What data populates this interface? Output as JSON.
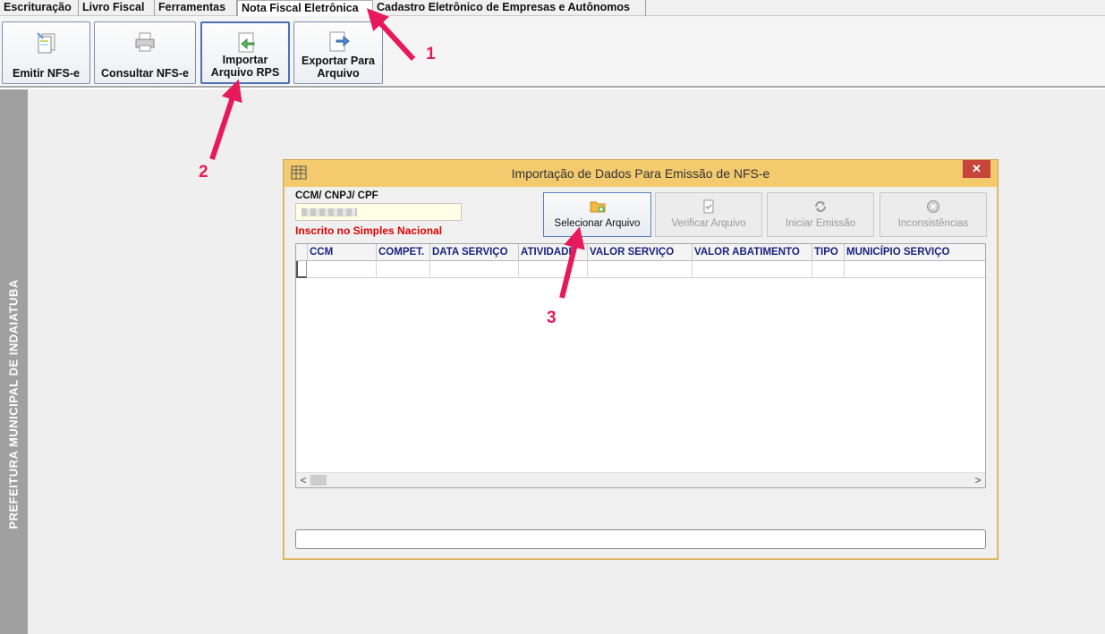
{
  "menu": {
    "tabs": [
      {
        "label": "Escrituração"
      },
      {
        "label": "Livro Fiscal"
      },
      {
        "label": "Ferramentas"
      },
      {
        "label": "Nota Fiscal Eletrônica"
      },
      {
        "label": "Cadastro Eletrônico de Empresas e Autônomos"
      }
    ],
    "active_tab": "Nota Fiscal Eletrônica"
  },
  "toolbar": {
    "buttons": [
      {
        "label": "Emitir NFS-e",
        "icon": "emit-document-icon"
      },
      {
        "label": "Consultar NFS-e",
        "icon": "printer-icon"
      },
      {
        "label": "Importar Arquivo RPS",
        "icon": "import-arrow-icon"
      },
      {
        "label": "Exportar Para Arquivo",
        "icon": "export-arrow-icon"
      }
    ]
  },
  "sidebar": {
    "text": "PREFEITURA MUNICIPAL DE INDAIATUBA"
  },
  "dialog": {
    "title": "Importação de Dados Para Emissão de NFS-e",
    "close_symbol": "✕",
    "ccm_label": "CCM/ CNPJ/ CPF",
    "ccm_value": "",
    "simples_status": "Inscrito no Simples Nacional",
    "buttons": [
      {
        "label": "Selecionar Arquivo",
        "enabled": true,
        "icon": "folder-add-icon"
      },
      {
        "label": "Verificar Arquivo",
        "enabled": false,
        "icon": "document-check-icon"
      },
      {
        "label": "Iniciar Emissão",
        "enabled": false,
        "icon": "refresh-icon"
      },
      {
        "label": "Inconsistências",
        "enabled": false,
        "icon": "error-circle-icon"
      }
    ],
    "grid": {
      "columns": [
        "CCM",
        "COMPET.",
        "DATA SERVIÇO",
        "ATIVIDADE",
        "VALOR SERVIÇO",
        "VALOR ABATIMENTO",
        "TIPO",
        "MUNICÍPIO SERVIÇO"
      ]
    },
    "scroll_left": "<",
    "scroll_right": ">"
  },
  "annotations": [
    "1",
    "2",
    "3"
  ],
  "colors": {
    "accent_pink": "#e8195a",
    "dialog_title": "#f3ca6e",
    "warning_red": "#e00000",
    "header_text": "#1a237e"
  }
}
